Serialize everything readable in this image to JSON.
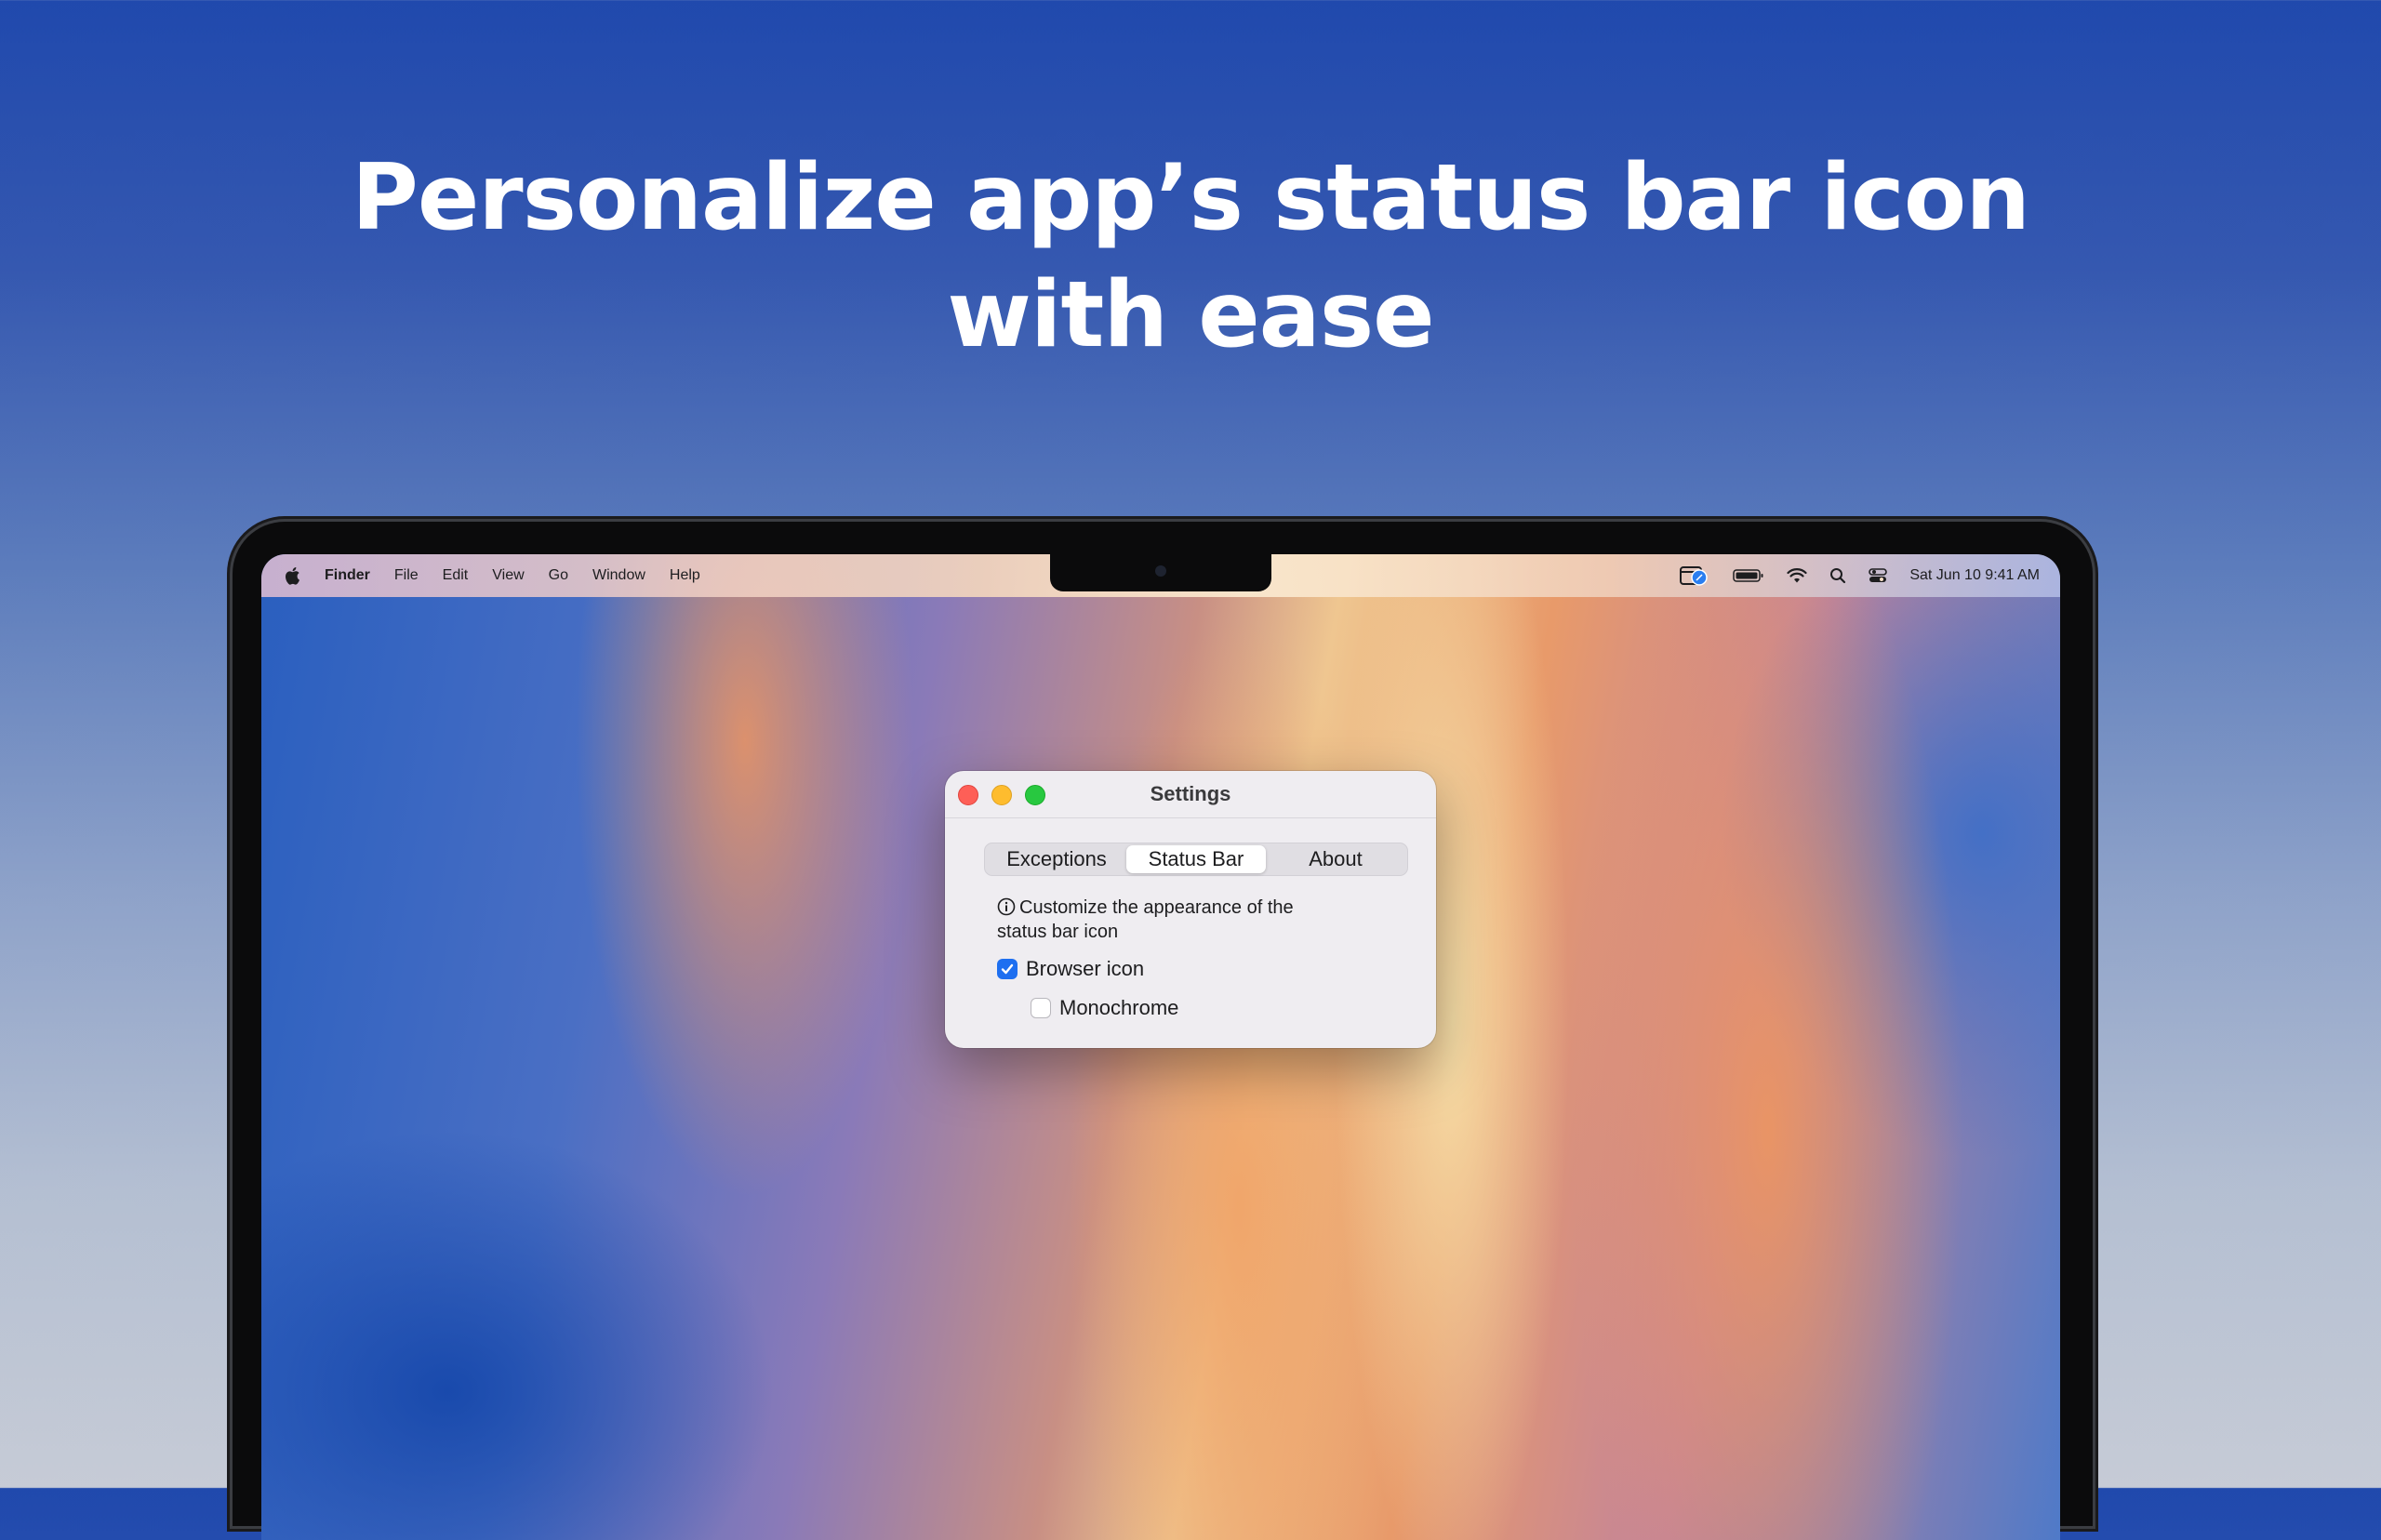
{
  "headline": {
    "line1": "Personalize app’s status bar icon",
    "line2": "with ease"
  },
  "menubar": {
    "app_name": "Finder",
    "menus": [
      "File",
      "Edit",
      "View",
      "Go",
      "Window",
      "Help"
    ],
    "clock": "Sat Jun 10  9:41 AM"
  },
  "window": {
    "title": "Settings",
    "tabs": [
      {
        "label": "Exceptions",
        "active": false
      },
      {
        "label": "Status Bar",
        "active": true
      },
      {
        "label": "About",
        "active": false
      }
    ],
    "info_line1": "Customize the appearance of the",
    "info_line2": "status bar icon",
    "browser_icon": {
      "label": "Browser icon",
      "checked": true
    },
    "monochrome": {
      "label": "Monochrome",
      "checked": false
    }
  },
  "colors": {
    "accent": "#1e6ff0",
    "close": "#fe5f57",
    "minimize": "#febc2e",
    "maximize": "#28c840"
  },
  "icons": [
    "apple-logo-icon",
    "browser-status-icon",
    "battery-icon",
    "wifi-icon",
    "search-icon",
    "control-center-icon",
    "info-icon",
    "checkmark-icon"
  ]
}
